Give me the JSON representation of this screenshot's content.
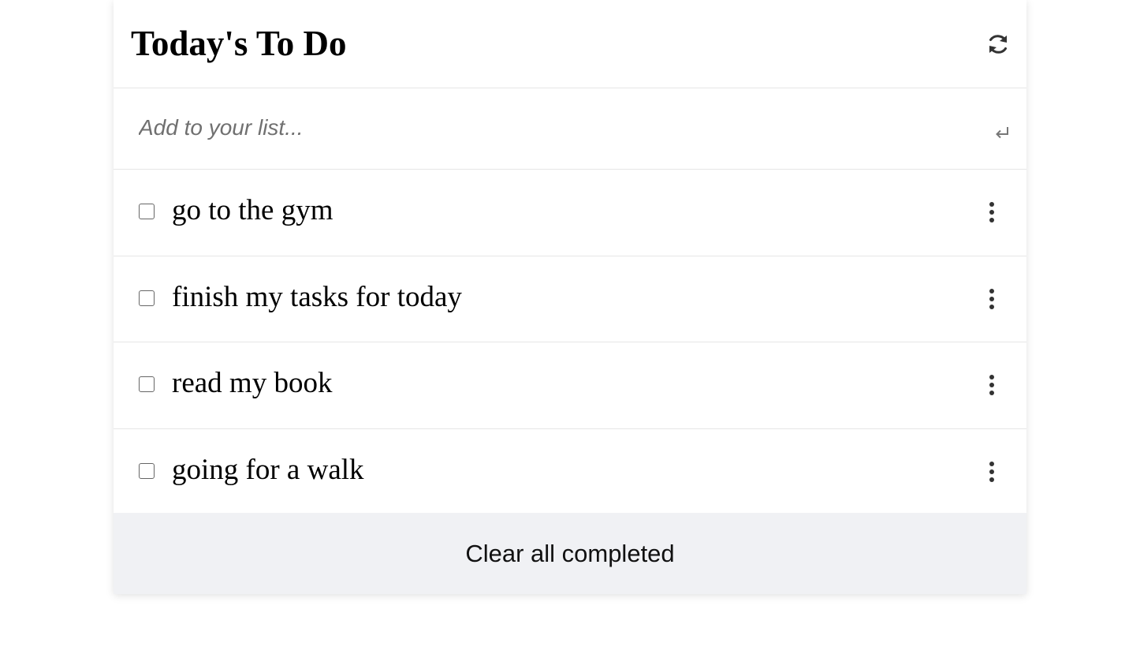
{
  "app": {
    "title": "Today's To Do",
    "refresh_icon": "refresh-icon"
  },
  "add": {
    "placeholder": "Add to your list...",
    "value": "",
    "submit_icon": "enter-return-icon"
  },
  "todos": [
    {
      "text": "go to the gym",
      "completed": false
    },
    {
      "text": "finish my tasks for today",
      "completed": false
    },
    {
      "text": "read my book",
      "completed": false
    },
    {
      "text": "going for a walk",
      "completed": false
    }
  ],
  "footer": {
    "clear_label": "Clear all completed"
  },
  "colors": {
    "footer_bg": "#f0f1f4",
    "divider": "#e6e6e6",
    "icon": "#333333"
  }
}
